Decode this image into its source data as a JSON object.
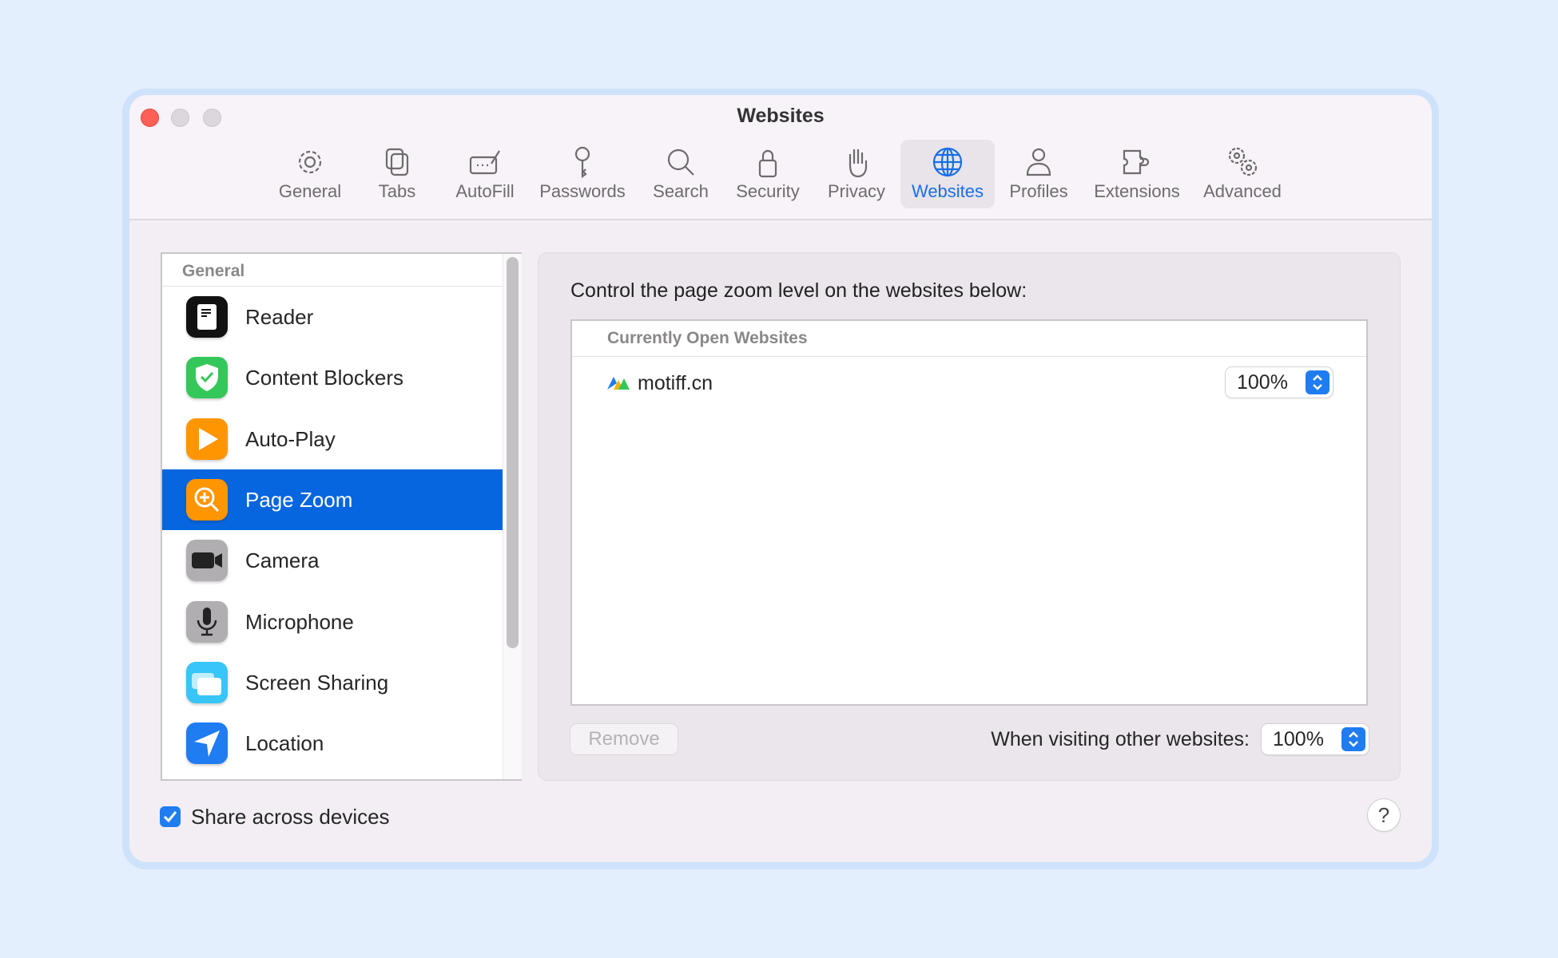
{
  "window": {
    "title": "Websites"
  },
  "toolbar": [
    {
      "label": "General",
      "icon": "gear-icon"
    },
    {
      "label": "Tabs",
      "icon": "tabs-icon"
    },
    {
      "label": "AutoFill",
      "icon": "autofill-icon"
    },
    {
      "label": "Passwords",
      "icon": "key-icon"
    },
    {
      "label": "Search",
      "icon": "search-icon"
    },
    {
      "label": "Security",
      "icon": "lock-icon"
    },
    {
      "label": "Privacy",
      "icon": "hand-icon"
    },
    {
      "label": "Websites",
      "icon": "globe-icon",
      "selected": true
    },
    {
      "label": "Profiles",
      "icon": "person-icon"
    },
    {
      "label": "Extensions",
      "icon": "puzzle-icon"
    },
    {
      "label": "Advanced",
      "icon": "gears-icon"
    }
  ],
  "sidebar": {
    "header": "General",
    "items": [
      {
        "label": "Reader",
        "icon": "reader-icon"
      },
      {
        "label": "Content Blockers",
        "icon": "shield-check-icon"
      },
      {
        "label": "Auto-Play",
        "icon": "play-icon"
      },
      {
        "label": "Page Zoom",
        "icon": "zoom-in-icon",
        "selected": true
      },
      {
        "label": "Camera",
        "icon": "camera-icon"
      },
      {
        "label": "Microphone",
        "icon": "microphone-icon"
      },
      {
        "label": "Screen Sharing",
        "icon": "screen-sharing-icon"
      },
      {
        "label": "Location",
        "icon": "location-arrow-icon"
      }
    ]
  },
  "main": {
    "description": "Control the page zoom level on the websites below:",
    "table_header": "Currently Open Websites",
    "sites": [
      {
        "name": "motiff.cn",
        "zoom": "100%"
      }
    ],
    "remove_label": "Remove",
    "other_label": "When visiting other websites:",
    "other_zoom": "100%"
  },
  "footer": {
    "share_label": "Share across devices",
    "share_checked": true,
    "help_label": "?"
  },
  "colors": {
    "accent": "#0566df",
    "close": "#fe5f57"
  }
}
